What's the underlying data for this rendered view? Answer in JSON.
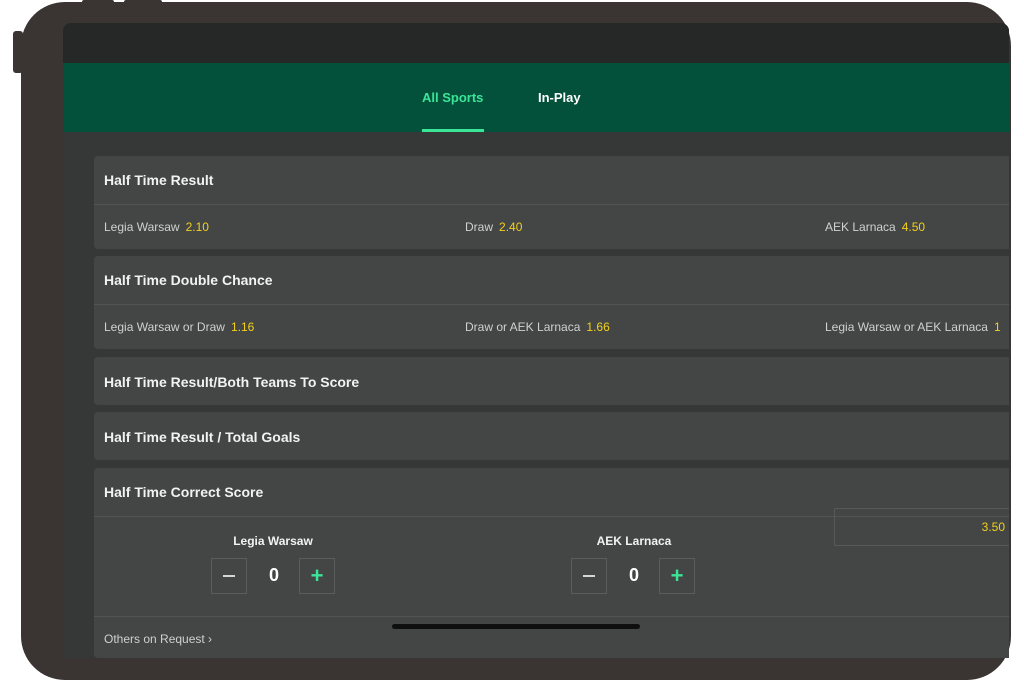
{
  "nav": {
    "tabs": [
      {
        "label": "All Sports",
        "active": true
      },
      {
        "label": "In-Play",
        "active": false
      }
    ]
  },
  "markets": {
    "half_time_result": {
      "title": "Half Time Result",
      "selections": [
        {
          "name": "Legia Warsaw",
          "odds": "2.10"
        },
        {
          "name": "Draw",
          "odds": "2.40"
        },
        {
          "name": "AEK Larnaca",
          "odds": "4.50"
        }
      ]
    },
    "half_time_double_chance": {
      "title": "Half Time Double Chance",
      "selections": [
        {
          "name": "Legia Warsaw or Draw",
          "odds": "1.16"
        },
        {
          "name": "Draw or AEK Larnaca",
          "odds": "1.66"
        },
        {
          "name": "Legia Warsaw or AEK Larnaca",
          "odds": "1"
        }
      ]
    },
    "btts": {
      "title": "Half Time Result/Both Teams To Score"
    },
    "total_goals": {
      "title": "Half Time Result / Total Goals"
    },
    "correct_score": {
      "title": "Half Time Correct Score",
      "home": {
        "team": "Legia Warsaw",
        "score": "0"
      },
      "away": {
        "team": "AEK Larnaca",
        "score": "0"
      },
      "result_odds": "3.50",
      "others_label": "Others on Request ›"
    }
  },
  "colors": {
    "brand_green": "#03513b",
    "accent_green": "#3be598",
    "odds_yellow": "#f3d01c"
  },
  "icons": {
    "minus": "minus-icon",
    "plus": "plus-icon"
  }
}
